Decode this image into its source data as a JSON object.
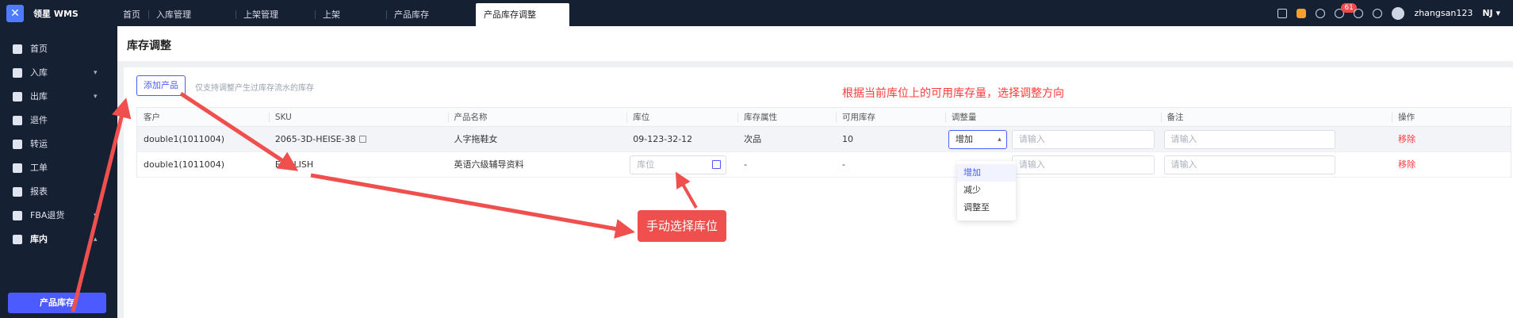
{
  "app": {
    "brand": "领星 WMS"
  },
  "tabs": [
    "首页",
    "入库管理",
    "上架管理",
    "上架",
    "产品库存",
    "产品库存调整"
  ],
  "header": {
    "notification_count": "61",
    "username": "zhangsan123",
    "region": "NJ"
  },
  "sidebar": {
    "items": [
      {
        "label": "首页",
        "icon": "home-icon"
      },
      {
        "label": "入库",
        "icon": "inbound-icon"
      },
      {
        "label": "出库",
        "icon": "outbound-icon"
      },
      {
        "label": "退件",
        "icon": "return-icon"
      },
      {
        "label": "转运",
        "icon": "transfer-icon"
      },
      {
        "label": "工单",
        "icon": "workorder-icon"
      },
      {
        "label": "报表",
        "icon": "report-icon"
      },
      {
        "label": "FBA退货",
        "icon": "fba-return-icon"
      },
      {
        "label": "库内",
        "icon": "warehouse-icon"
      }
    ],
    "sub_active": "产品库存"
  },
  "page": {
    "title": "库存调整",
    "add_button": "添加产品",
    "hint": "仅支持调整产生过库存流水的库存",
    "annotation": "根据当前库位上的可用库存量，选择调整方向",
    "callout": "手动选择库位"
  },
  "table": {
    "headers": [
      "客户",
      "SKU",
      "产品名称",
      "库位",
      "库存属性",
      "可用库存",
      "调整量",
      "备注",
      "操作"
    ],
    "rows": [
      {
        "customer": "double1(1011004)",
        "sku": "2065-3D-HEISE-38",
        "name": "人字拖鞋女",
        "location": "09-123-32-12",
        "attr": "次品",
        "available": "10",
        "direction": "增加",
        "qty_placeholder": "请输入",
        "remark_placeholder": "请输入",
        "action": "移除"
      },
      {
        "customer": "double1(1011004)",
        "sku": "ENGLISH",
        "name": "英语六级辅导资料",
        "location_placeholder": "库位",
        "attr": "-",
        "available": "-",
        "direction": "增加",
        "qty_placeholder": "请输入",
        "remark_placeholder": "请输入",
        "action": "移除"
      }
    ]
  },
  "dropdown": {
    "options": [
      "增加",
      "减少",
      "调整至"
    ]
  }
}
